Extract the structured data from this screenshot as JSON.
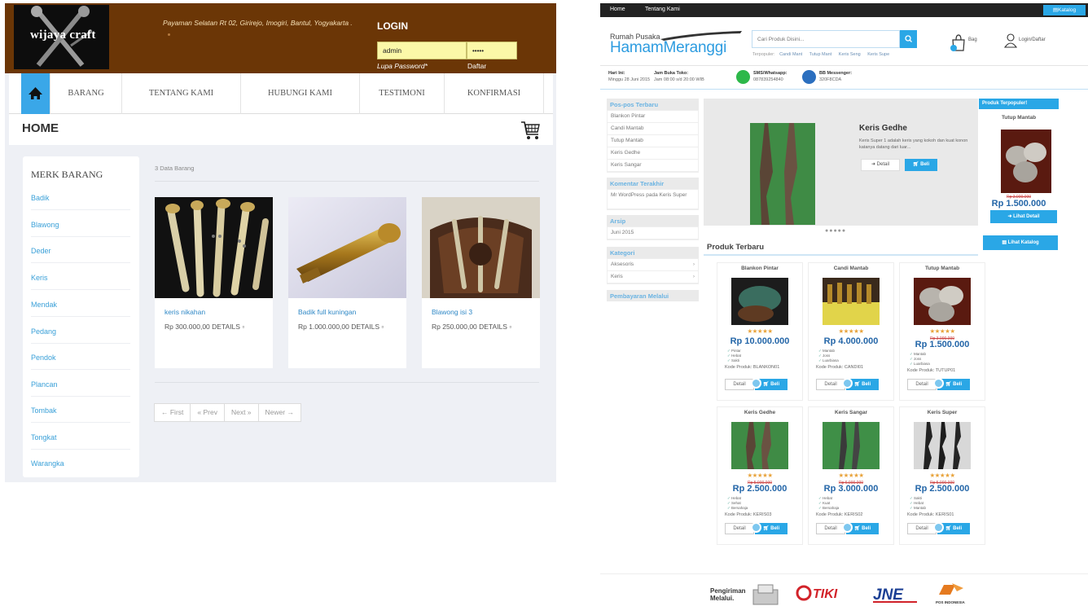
{
  "left": {
    "logo_text": "wijaya craft",
    "address": "Payaman Selatan Rt 02, Girirejo, Imogiri, Bantul, Yogyakarta .",
    "login_title": "LOGIN",
    "username_value": "admin",
    "password_value": "•••••",
    "forgot_password": "Lupa Password*",
    "register": "Daftar",
    "nav": [
      "BARANG",
      "TENTANG KAMI",
      "HUBUNGI KAMI",
      "TESTIMONI",
      "KONFIRMASI"
    ],
    "page_title": "HOME",
    "sidebar_title": "MERK BARANG",
    "brands": [
      "Badik",
      "Blawong",
      "Deder",
      "Keris",
      "Mendak",
      "Pedang",
      "Pendok",
      "Plancan",
      "Tombak",
      "Tongkat",
      "Warangka"
    ],
    "count_text": "3 Data Barang",
    "products": [
      {
        "name": "keris nikahan",
        "price": "Rp 300.000,00",
        "details": "DETAILS"
      },
      {
        "name": "Badik full kuningan",
        "price": "Rp 1.000.000,00",
        "details": "DETAILS"
      },
      {
        "name": "Blawong isi 3",
        "price": "Rp 250.000,00",
        "details": "DETAILS"
      }
    ],
    "pager": [
      "← First",
      "« Prev",
      "Next »",
      "Newer →"
    ]
  },
  "right": {
    "top_links": [
      "Home",
      "Tentang Kami"
    ],
    "top_katalog": "Katalog",
    "brand_small": "Rumah Pusaka",
    "brand_big": "HamamMeranggi",
    "search_placeholder": "Cari Produk Disini...",
    "quick_label": "Terpopuler:",
    "quick_links": [
      "Candi Mant",
      "Tutup Mant",
      "Keris Seng",
      "Keris Supe"
    ],
    "bag_label": "Bag",
    "login_label": "Login/Daftar",
    "info": {
      "hari_label": "Hari Ini:",
      "hari_value": "Minggu 28 Juni 2015",
      "jam_label": "Jam Buka Toko:",
      "jam_value": "Jam 08:00 s/d 20:00 WIB",
      "sms_label": "SMS/Whatsapp:",
      "sms_value": "087839254840",
      "bb_label": "BB Messenger:",
      "bb_value": "320F8CDA"
    },
    "widgets": {
      "pos_title": "Pos-pos Terbaru",
      "pos_items": [
        "Blankon Pintar",
        "Candi Mantab",
        "Tutup Mantab",
        "Keris Gedhe",
        "Keris Sangar"
      ],
      "komentar_title": "Komentar Terakhir",
      "komentar_item": "Mr WordPress pada Keris Super",
      "arsip_title": "Arsip",
      "arsip_item": "Juni 2015",
      "kategori_title": "Kategori",
      "kategori_items": [
        "Aksesoris",
        "Keris"
      ],
      "pembayaran_title": "Pembayaran Melalui"
    },
    "slider": {
      "title": "Keris Gedhe",
      "desc": "Keris Super 1 adalah keris yang kokoh dan kuat konon katanya datang dari luar...",
      "detail": "Detail",
      "beli": "Beli",
      "dots": "●●●●●"
    },
    "produk_terbaru": "Produk Terbaru",
    "products": [
      {
        "name": "Blankon Pintar",
        "old": "",
        "price": "Rp 10.000.000",
        "features": [
          "Pintar",
          "Hebat",
          "Sakti"
        ],
        "kode": "Kode Produk: BLANKON01"
      },
      {
        "name": "Candi Mantab",
        "old": "",
        "price": "Rp 4.000.000",
        "features": [
          "Mantab",
          "Joss",
          "Luarbiasa"
        ],
        "kode": "Kode Produk: CANDI01"
      },
      {
        "name": "Tutup Mantab",
        "old": "Rp 3.000.000",
        "price": "Rp 1.500.000",
        "features": [
          "Mantab",
          "Joss",
          "Luarbiasa"
        ],
        "kode": "Kode Produk: TUTUP01"
      },
      {
        "name": "Keris Gedhe",
        "old": "Rp 5.000.000",
        "price": "Rp 2.500.000",
        "features": [
          "Hebat",
          "Sehat",
          "Bersahaja"
        ],
        "kode": "Kode Produk: KERIS03"
      },
      {
        "name": "Keris Sangar",
        "old": "Rp 6.000.000",
        "price": "Rp 3.000.000",
        "features": [
          "Hebat",
          "Kuat",
          "Bersahaja"
        ],
        "kode": "Kode Produk: KERIS02"
      },
      {
        "name": "Keris Super",
        "old": "Rp 5.000.000",
        "price": "Rp 2.500.000",
        "features": [
          "Sakti",
          "Hebat",
          "Mantab"
        ],
        "kode": "Kode Produk: KERIS01"
      }
    ],
    "card_detail": "Detail",
    "card_beli": "Beli",
    "stars": "★★★★★",
    "popular": {
      "title": "Produk Terpopuler!",
      "name": "Tutup Mantab",
      "old": "Rp 3.000.000",
      "price": "Rp 1.500.000",
      "btn": "Lihat Detail"
    },
    "katalog_btn": "Lihat Katalog",
    "shipping_label": "Pengiriman Melalui.",
    "couriers": [
      "TIKI",
      "JNE",
      "POS INDONESIA"
    ]
  }
}
